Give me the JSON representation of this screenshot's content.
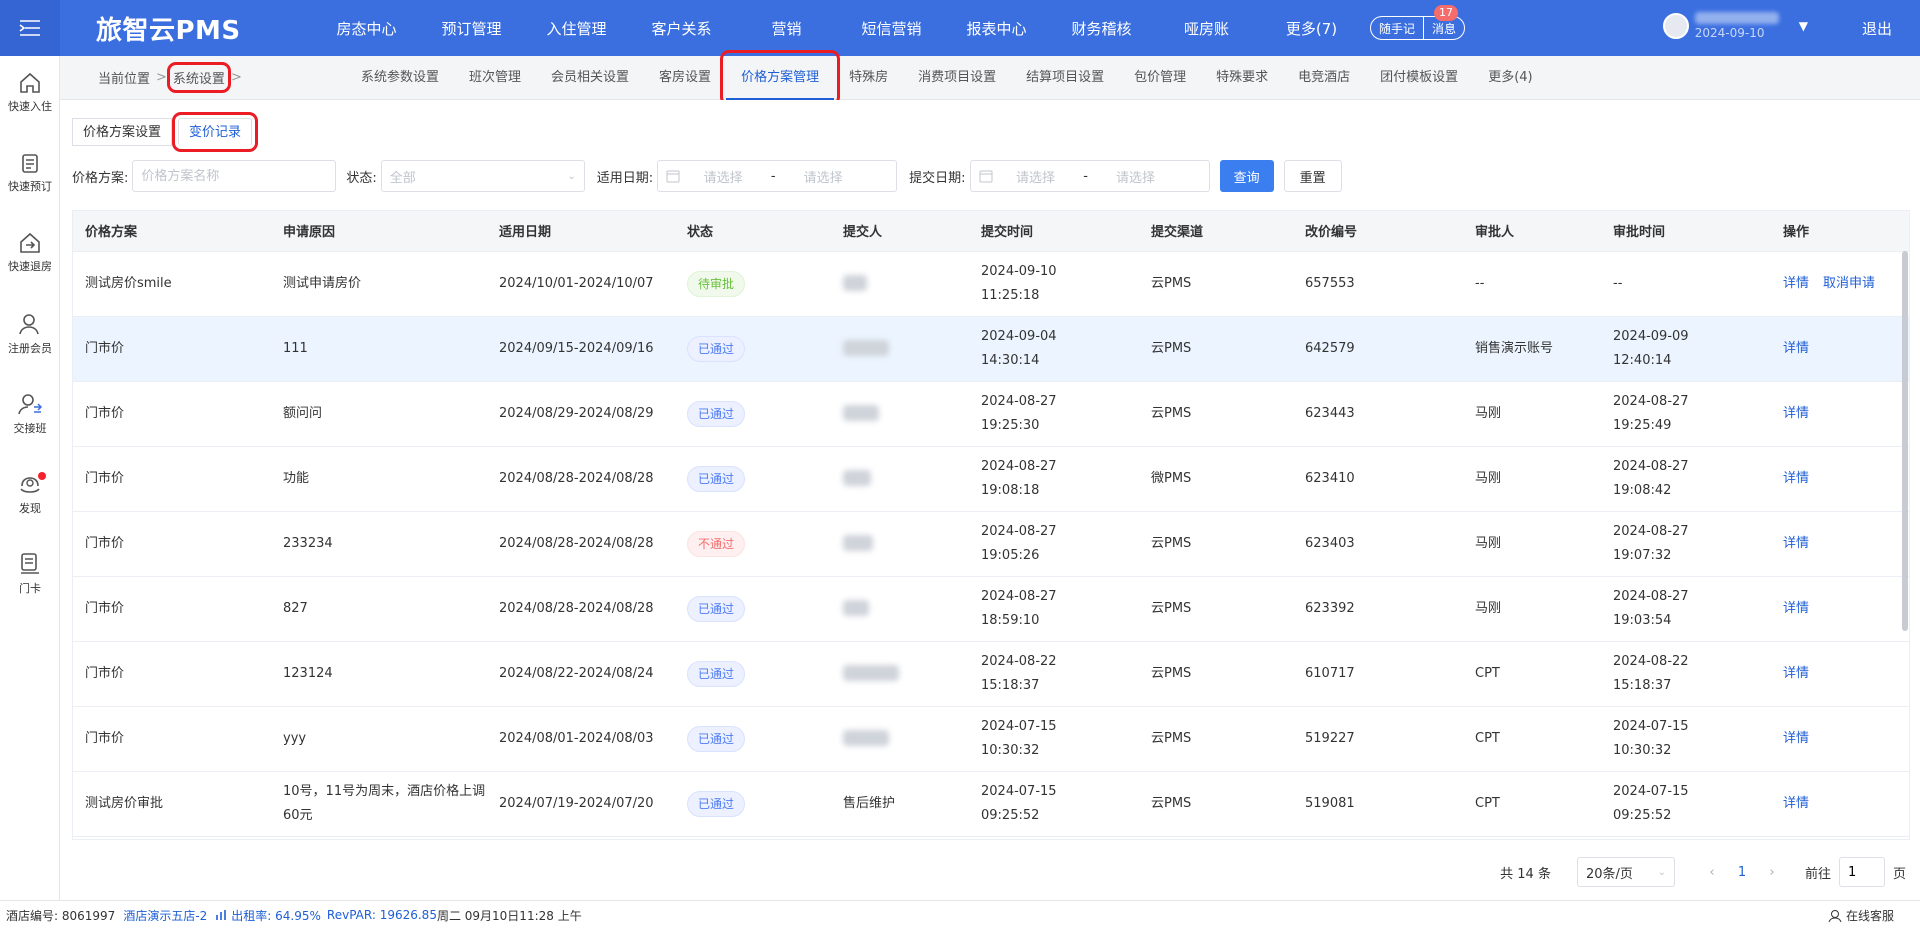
{
  "app": {
    "logo": "旅智云PMS",
    "nav": [
      "房态中心",
      "预订管理",
      "入住管理",
      "客户关系",
      "营销",
      "短信营销",
      "报表中心",
      "财务稽核",
      "哑房账",
      "更多(7)"
    ],
    "quick_notes": "随手记",
    "messages": "消息",
    "message_count": "17",
    "user_date": "2024-09-10",
    "logout": "退出"
  },
  "sidebar": [
    {
      "label": "快速入住",
      "icon": "home-icon"
    },
    {
      "label": "快速预订",
      "icon": "booking-icon"
    },
    {
      "label": "快速退房",
      "icon": "checkout-icon"
    },
    {
      "label": "注册会员",
      "icon": "user-add-icon"
    },
    {
      "label": "交接班",
      "icon": "shift-icon"
    },
    {
      "label": "发现",
      "icon": "discover-icon"
    },
    {
      "label": "门卡",
      "icon": "card-icon"
    }
  ],
  "breadcrumb": {
    "root": "当前位置",
    "current": "系统设置"
  },
  "subtabs": [
    "系统参数设置",
    "班次管理",
    "会员相关设置",
    "客房设置",
    "价格方案管理",
    "特殊房",
    "消费项目设置",
    "结算项目设置",
    "包价管理",
    "特殊要求",
    "电竞酒店",
    "团付模板设置",
    "更多(4)"
  ],
  "subtabs_active": 4,
  "inner_tabs": [
    "价格方案设置",
    "变价记录"
  ],
  "filters": {
    "plan_label": "价格方案:",
    "plan_placeholder": "价格方案名称",
    "status_label": "状态:",
    "status_value": "全部",
    "apply_date_label": "适用日期:",
    "submit_date_label": "提交日期:",
    "date_start_placeholder": "请选择",
    "date_sep": "-",
    "date_end_placeholder": "请选择",
    "query": "查询",
    "reset": "重置"
  },
  "table": {
    "columns": [
      "价格方案",
      "申请原因",
      "适用日期",
      "状态",
      "提交人",
      "提交时间",
      "提交渠道",
      "改价编号",
      "审批人",
      "审批时间",
      "操作"
    ],
    "rows": [
      {
        "plan": "测试房价smile",
        "reason": "测试申请房价",
        "dates": "2024/10/01-2024/10/07",
        "status": "待审批",
        "status_type": "pending",
        "submitter": "",
        "submit_time_date": "2024-09-10",
        "submit_time_clock": "11:25:18",
        "channel": "云PMS",
        "code": "657553",
        "approver": "--",
        "approve_time_date": "--",
        "approve_time_clock": "",
        "actions": [
          "详情",
          "取消申请"
        ]
      },
      {
        "plan": "门市价",
        "reason": "111",
        "dates": "2024/09/15-2024/09/16",
        "status": "已通过",
        "status_type": "approved",
        "submitter": "",
        "submit_time_date": "2024-09-04",
        "submit_time_clock": "14:30:14",
        "channel": "云PMS",
        "code": "642579",
        "approver": "销售演示账号",
        "approve_time_date": "2024-09-09",
        "approve_time_clock": "12:40:14",
        "actions": [
          "详情"
        ]
      },
      {
        "plan": "门市价",
        "reason": "额问问",
        "dates": "2024/08/29-2024/08/29",
        "status": "已通过",
        "status_type": "approved",
        "submitter": "",
        "submit_time_date": "2024-08-27",
        "submit_time_clock": "19:25:30",
        "channel": "云PMS",
        "code": "623443",
        "approver": "马刚",
        "approve_time_date": "2024-08-27",
        "approve_time_clock": "19:25:49",
        "actions": [
          "详情"
        ]
      },
      {
        "plan": "门市价",
        "reason": "功能",
        "dates": "2024/08/28-2024/08/28",
        "status": "已通过",
        "status_type": "approved",
        "submitter": "",
        "submit_time_date": "2024-08-27",
        "submit_time_clock": "19:08:18",
        "channel": "微PMS",
        "code": "623410",
        "approver": "马刚",
        "approve_time_date": "2024-08-27",
        "approve_time_clock": "19:08:42",
        "actions": [
          "详情"
        ]
      },
      {
        "plan": "门市价",
        "reason": "233234",
        "dates": "2024/08/28-2024/08/28",
        "status": "不通过",
        "status_type": "rejected",
        "submitter": "",
        "submit_time_date": "2024-08-27",
        "submit_time_clock": "19:05:26",
        "channel": "云PMS",
        "code": "623403",
        "approver": "马刚",
        "approve_time_date": "2024-08-27",
        "approve_time_clock": "19:07:32",
        "actions": [
          "详情"
        ]
      },
      {
        "plan": "门市价",
        "reason": "827",
        "dates": "2024/08/28-2024/08/28",
        "status": "已通过",
        "status_type": "approved",
        "submitter": "",
        "submit_time_date": "2024-08-27",
        "submit_time_clock": "18:59:10",
        "channel": "云PMS",
        "code": "623392",
        "approver": "马刚",
        "approve_time_date": "2024-08-27",
        "approve_time_clock": "19:03:54",
        "actions": [
          "详情"
        ]
      },
      {
        "plan": "门市价",
        "reason": "123124",
        "dates": "2024/08/22-2024/08/24",
        "status": "已通过",
        "status_type": "approved",
        "submitter": "",
        "submit_time_date": "2024-08-22",
        "submit_time_clock": "15:18:37",
        "channel": "云PMS",
        "code": "610717",
        "approver": "CPT",
        "approve_time_date": "2024-08-22",
        "approve_time_clock": "15:18:37",
        "actions": [
          "详情"
        ]
      },
      {
        "plan": "门市价",
        "reason": "yyy",
        "dates": "2024/08/01-2024/08/03",
        "status": "已通过",
        "status_type": "approved",
        "submitter": "",
        "submit_time_date": "2024-07-15",
        "submit_time_clock": "10:30:32",
        "channel": "云PMS",
        "code": "519227",
        "approver": "CPT",
        "approve_time_date": "2024-07-15",
        "approve_time_clock": "10:30:32",
        "actions": [
          "详情"
        ]
      },
      {
        "plan": "测试房价审批",
        "reason": "10号，11号为周末，酒店价格上调60元",
        "dates": "2024/07/19-2024/07/20",
        "status": "已通过",
        "status_type": "approved",
        "submitter": "售后维护",
        "submit_time_date": "2024-07-15",
        "submit_time_clock": "09:25:52",
        "channel": "云PMS",
        "code": "519081",
        "approver": "CPT",
        "approve_time_date": "2024-07-15",
        "approve_time_clock": "09:25:52",
        "actions": [
          "详情"
        ]
      }
    ]
  },
  "pagination": {
    "total": "共 14 条",
    "page_size": "20条/页",
    "current": "1",
    "goto_prefix": "前往",
    "goto_value": "1",
    "goto_suffix": "页"
  },
  "statusbar": {
    "hotel_code_label": "酒店编号: 8061997",
    "hotel_name": "酒店演示五店-2",
    "occupancy": "出租率: 64.95%",
    "revpar": "RevPAR: 19626.85",
    "datetime": "周二 09月10日11:28 上午",
    "service": "在线客服"
  },
  "colors": {
    "primary": "#3b6fe0",
    "link": "#1f5fd6",
    "highlight": "#ec1c24",
    "pending": "#67c23a",
    "approved": "#4d7cf4",
    "rejected": "#f56c6c"
  }
}
